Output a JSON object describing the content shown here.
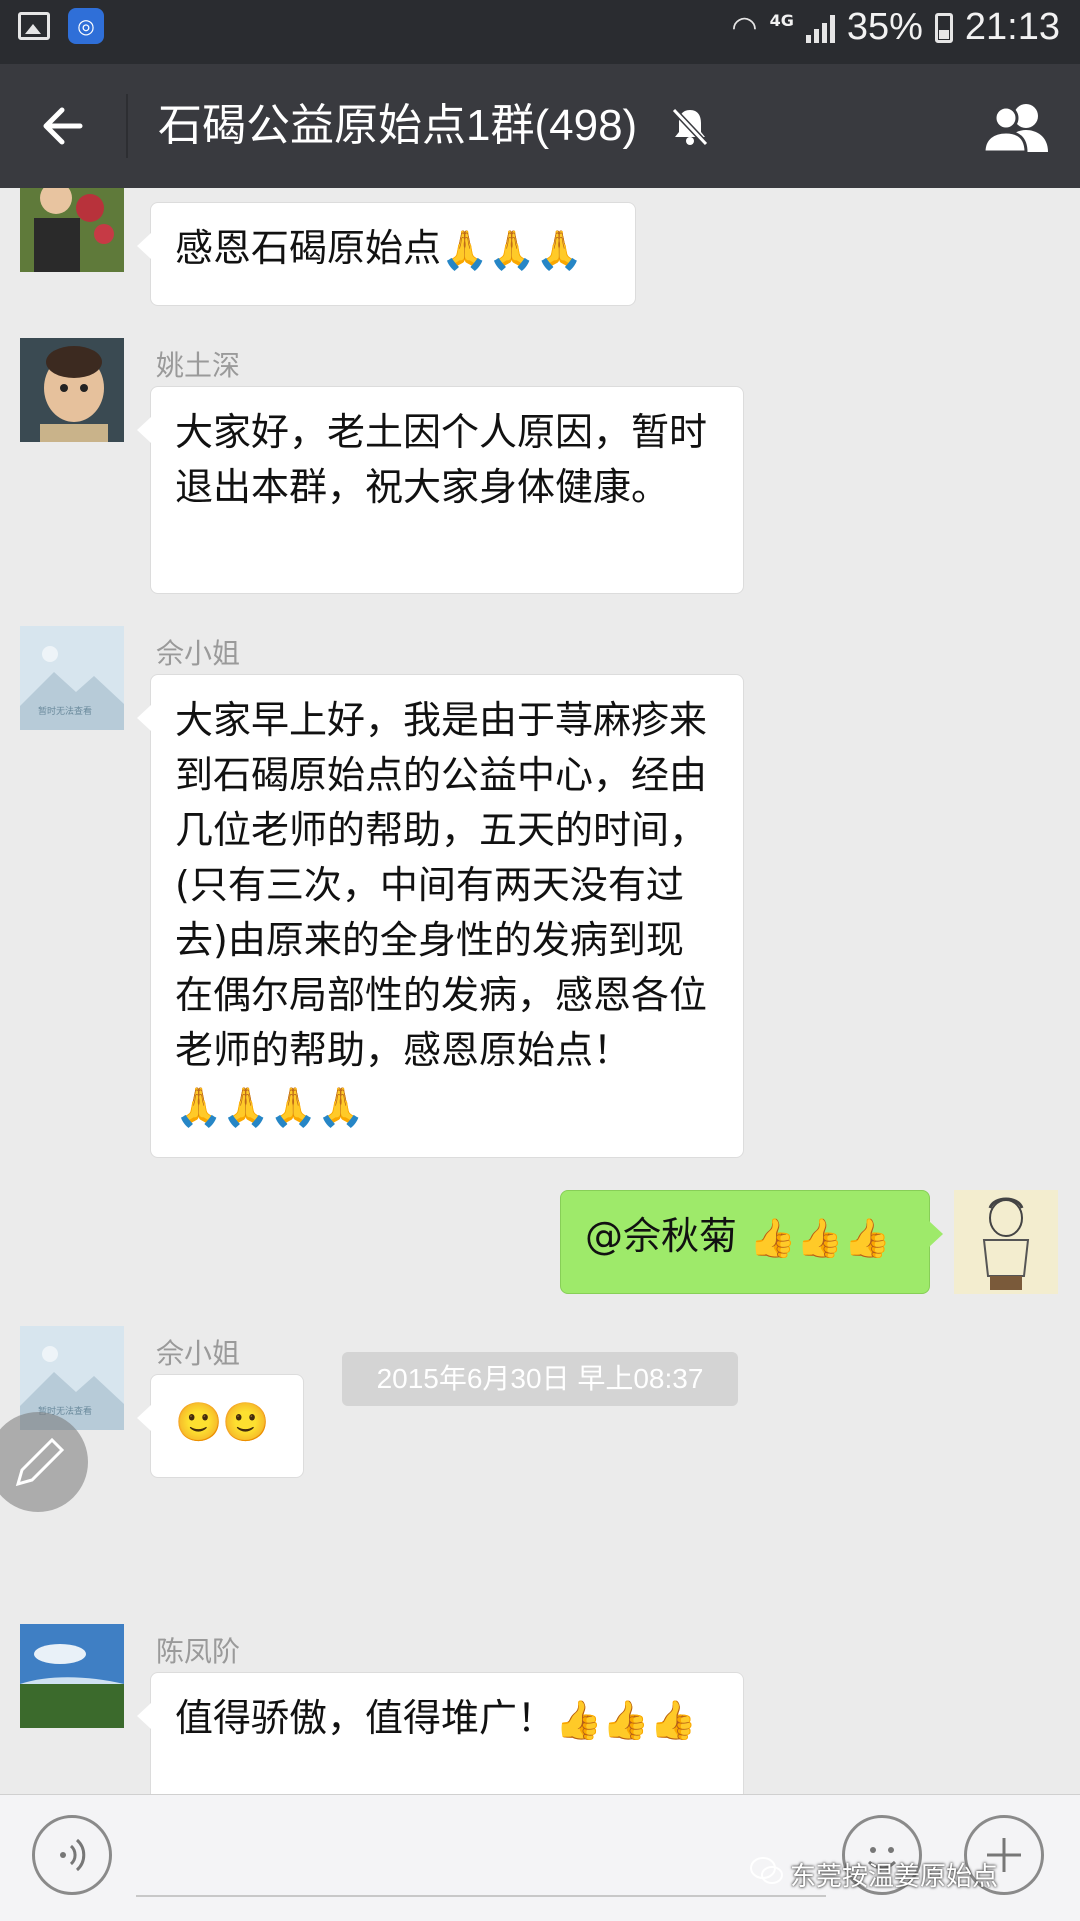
{
  "status_bar": {
    "network": "4G",
    "battery": "35%",
    "time": "21:13"
  },
  "header": {
    "title": "石碣公益原始点1群(498)"
  },
  "messages": [
    {
      "side": "left",
      "sender": "",
      "text": "感恩石碣原始点",
      "emoji": "🙏🙏🙏"
    },
    {
      "side": "left",
      "sender": "姚土深",
      "text": "大家好，老土因个人原因，暂时退出本群，祝大家身体健康。"
    },
    {
      "side": "left",
      "sender": "佘小姐",
      "text": "大家早上好，我是由于荨麻疹来到石碣原始点的公益中心，经由几位老师的帮助，五天的时间，(只有三次，中间有两天没有过去)由原来的全身性的发病到现在偶尔局部性的发病，感恩各位老师的帮助，感恩原始点！",
      "emoji": "🙏🙏🙏🙏"
    },
    {
      "side": "right",
      "text": "@佘秋菊 ",
      "emoji": "👍👍👍"
    },
    {
      "side": "left",
      "sender": "佘小姐",
      "emoji": "🙂🙂"
    },
    {
      "side": "left",
      "sender": "陈凤阶",
      "text": "值得骄傲，值得堆广！",
      "emoji": "👍👍👍"
    }
  ],
  "timestamp": "2015年6月30日 早上08:37",
  "avatar_placeholder_text": "暂时无法查看",
  "watermark": "东莞按温姜原始点",
  "colors": {
    "status_bar": "#2a2c30",
    "header": "#393a3f",
    "chat_bg": "#ebebeb",
    "bubble_left": "#ffffff",
    "bubble_right": "#9eea6a"
  }
}
